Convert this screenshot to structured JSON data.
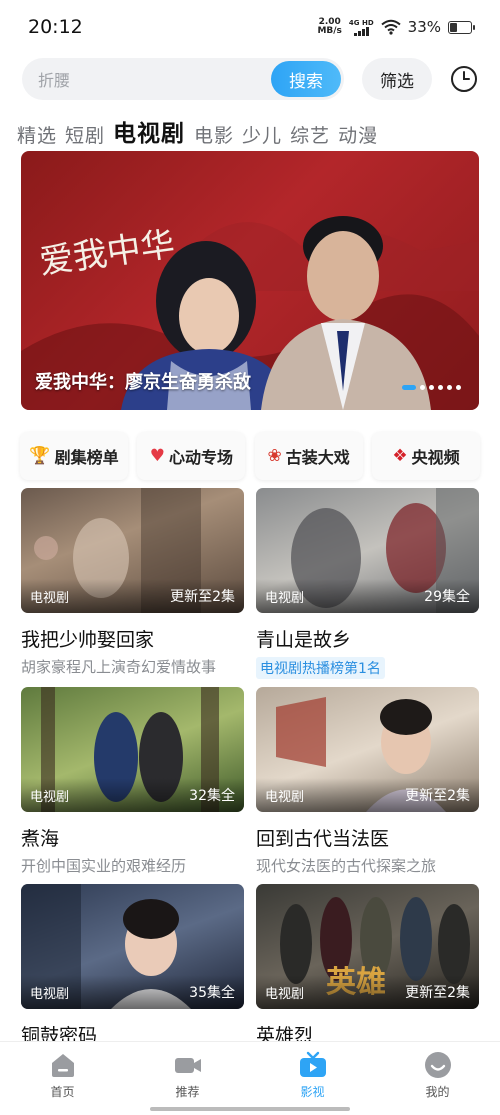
{
  "status": {
    "time": "20:12",
    "net_speed_value": "2.00",
    "net_speed_unit": "MB/s",
    "signal_label": "4G HD",
    "battery": "33%",
    "battery_level": 0.33
  },
  "search": {
    "placeholder": "折腰",
    "button": "搜索",
    "filter": "筛选"
  },
  "tabs": [
    {
      "label": "精选"
    },
    {
      "label": "短剧"
    },
    {
      "label": "电视剧",
      "active": true
    },
    {
      "label": "电影"
    },
    {
      "label": "少儿"
    },
    {
      "label": "综艺"
    },
    {
      "label": "动漫"
    }
  ],
  "banner": {
    "title": "爱我中华：廖京生奋勇杀敌",
    "calligraphy": "爱我中华",
    "dots": 6,
    "active_dot": 0
  },
  "shortcuts": [
    {
      "label": "剧集榜单",
      "icon": "trophy-icon",
      "glyph": "🏆",
      "color": "#e6a817"
    },
    {
      "label": "心动专场",
      "icon": "heart-icon",
      "glyph": "♥",
      "color": "#e53945"
    },
    {
      "label": "古装大戏",
      "icon": "fan-icon",
      "glyph": "❀",
      "color": "#d73a2f"
    },
    {
      "label": "央视频",
      "icon": "cctv-logo-icon",
      "glyph": "❖",
      "color": "#d5222a"
    }
  ],
  "cards": [
    {
      "category": "电视剧",
      "count": "更新至2集",
      "title": "我把少帅娶回家",
      "desc": "胡家豪程凡上演奇幻爱情故事"
    },
    {
      "category": "电视剧",
      "count": "29集全",
      "title": "青山是故乡",
      "tag": "电视剧热播榜第1名"
    },
    {
      "category": "电视剧",
      "count": "32集全",
      "title": "煮海",
      "desc": "开创中国实业的艰难经历"
    },
    {
      "category": "电视剧",
      "count": "更新至2集",
      "title": "回到古代当法医",
      "desc": "现代女法医的古代探案之旅"
    },
    {
      "category": "电视剧",
      "count": "35集全",
      "title": "铜鼓密码"
    },
    {
      "category": "电视剧",
      "count": "更新至2集",
      "title": "英雄烈",
      "poster_text": "英雄"
    }
  ],
  "nav": [
    {
      "label": "首页",
      "icon": "home-icon"
    },
    {
      "label": "推荐",
      "icon": "video-camera-icon"
    },
    {
      "label": "影视",
      "icon": "tv-icon",
      "active": true,
      "accent": "#2ea4f5"
    },
    {
      "label": "我的",
      "icon": "profile-icon"
    }
  ]
}
